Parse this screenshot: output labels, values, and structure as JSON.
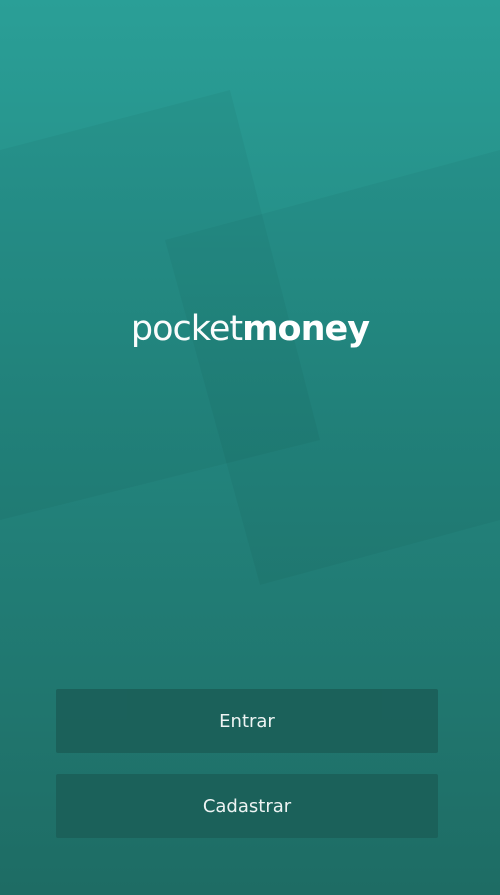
{
  "brand": {
    "name_light": "pocket",
    "name_bold": "money"
  },
  "actions": {
    "login_label": "Entrar",
    "register_label": "Cadastrar"
  },
  "colors": {
    "background_top": "#2a9f97",
    "background_bottom": "#1e6c64",
    "button": "#1b6059",
    "text": "#ffffff"
  }
}
